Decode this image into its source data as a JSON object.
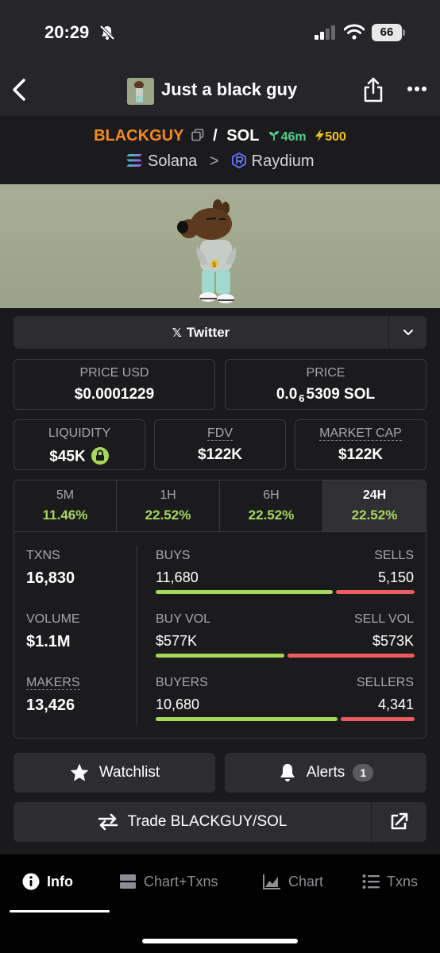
{
  "status_bar": {
    "time": "20:29",
    "battery": "66"
  },
  "header": {
    "title": "Just a black guy"
  },
  "pair": {
    "base": "BLACKGUY",
    "quote": "SOL",
    "age": "46m",
    "boosts": "500",
    "chain": "Solana",
    "dex": "Raydium"
  },
  "socials": {
    "twitter_label": "Twitter"
  },
  "metrics": {
    "price_usd_label": "PRICE USD",
    "price_usd": "$0.0001229",
    "price_label": "PRICE",
    "price_lead": "0.0",
    "price_zeros": "6",
    "price_tail": "5309 SOL",
    "liquidity_label": "LIQUIDITY",
    "liquidity": "$45K",
    "fdv_label": "FDV",
    "fdv": "$122K",
    "mcap_label": "MARKET CAP",
    "mcap": "$122K"
  },
  "timeframes": [
    {
      "label": "5M",
      "change": "11.46%",
      "active": false
    },
    {
      "label": "1H",
      "change": "22.52%",
      "active": false
    },
    {
      "label": "6H",
      "change": "22.52%",
      "active": false
    },
    {
      "label": "24H",
      "change": "22.52%",
      "active": true
    }
  ],
  "stats": {
    "txns_label": "TXNS",
    "txns": "16,830",
    "volume_label": "VOLUME",
    "volume": "$1.1M",
    "makers_label": "MAKERS",
    "makers": "13,426",
    "buys_label": "BUYS",
    "buys": "11,680",
    "sells_label": "SELLS",
    "sells": "5,150",
    "buy_vol_label": "BUY VOL",
    "buy_vol": "$577K",
    "sell_vol_label": "SELL VOL",
    "sell_vol": "$573K",
    "buyers_label": "BUYERS",
    "buyers": "10,680",
    "sellers_label": "SELLERS",
    "sellers": "4,341",
    "ratios": {
      "txns": 0.694,
      "volume": 0.502,
      "makers": 0.711
    }
  },
  "actions": {
    "watchlist": "Watchlist",
    "alerts": "Alerts",
    "alerts_count": "1",
    "trade": "Trade BLACKGUY/SOL"
  },
  "bottom_nav": [
    {
      "label": "Info",
      "icon": "info-icon",
      "active": true
    },
    {
      "label": "Chart+Txns",
      "icon": "layout-icon",
      "active": false
    },
    {
      "label": "Chart",
      "icon": "area-chart-icon",
      "active": false
    },
    {
      "label": "Txns",
      "icon": "list-icon",
      "active": false
    }
  ],
  "colors": {
    "accent": "#f5891f",
    "positive": "#a6d85a",
    "negative": "#ec5c5c",
    "age": "#4ecf86",
    "boost": "#f4c21a"
  }
}
